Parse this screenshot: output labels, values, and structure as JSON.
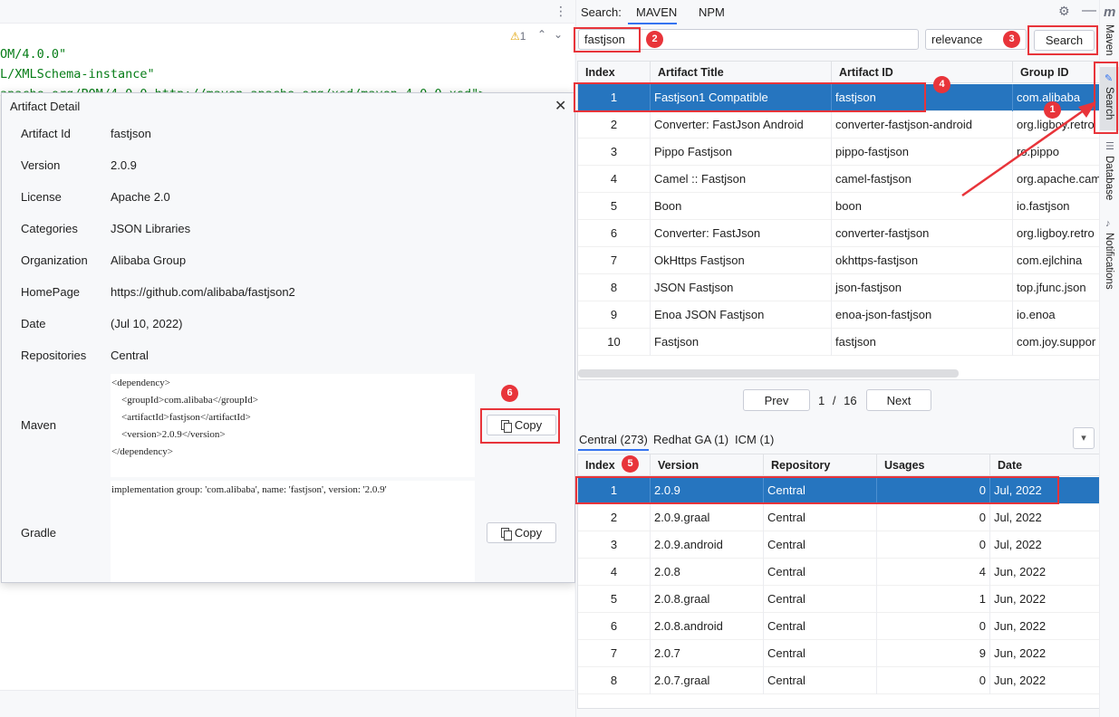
{
  "editor": {
    "code_lines": [
      "OM/4.0.0\"",
      "L/XMLSchema-instance\"",
      "apache.org/POM/4.0.0 http://maven.apache.org/xsd/maven-4.0.0.xsd\">"
    ],
    "warning_count": "1"
  },
  "dialog": {
    "title": "Artifact Detail",
    "fields": [
      {
        "label": "Artifact Id",
        "value": "fastjson"
      },
      {
        "label": "Version",
        "value": "2.0.9"
      },
      {
        "label": "License",
        "value": "Apache 2.0"
      },
      {
        "label": "Categories",
        "value": "JSON Libraries"
      },
      {
        "label": "Organization",
        "value": "Alibaba Group"
      },
      {
        "label": "HomePage",
        "value": "https://github.com/alibaba/fastjson2"
      },
      {
        "label": "Date",
        "value": "(Jul 10, 2022)"
      },
      {
        "label": "Repositories",
        "value": "Central"
      }
    ],
    "maven_label": "Maven",
    "maven_lines": [
      "<dependency>",
      "    <groupId>com.alibaba</groupId>",
      "    <artifactId>fastjson</artifactId>",
      "    <version>2.0.9</version>",
      "</dependency>"
    ],
    "gradle_label": "Gradle",
    "gradle_text": "implementation group: 'com.alibaba', name: 'fastjson', version: '2.0.9'",
    "copy_label": "Copy"
  },
  "panel": {
    "search_label": "Search:",
    "tabs": [
      "MAVEN",
      "NPM"
    ],
    "query": "fastjson",
    "sort": "relevance",
    "search_button": "Search",
    "artifact_columns": [
      "Index",
      "Artifact Title",
      "Artifact ID",
      "Group ID"
    ],
    "artifacts": [
      [
        "1",
        "Fastjson1 Compatible",
        "fastjson",
        "com.alibaba"
      ],
      [
        "2",
        "Converter: FastJson Android",
        "converter-fastjson-android",
        "org.ligboy.retro"
      ],
      [
        "3",
        "Pippo Fastjson",
        "pippo-fastjson",
        "ro.pippo"
      ],
      [
        "4",
        "Camel :: Fastjson",
        "camel-fastjson",
        "org.apache.cam"
      ],
      [
        "5",
        "Boon",
        "boon",
        "io.fastjson"
      ],
      [
        "6",
        "Converter: FastJson",
        "converter-fastjson",
        "org.ligboy.retro"
      ],
      [
        "7",
        "OkHttps Fastjson",
        "okhttps-fastjson",
        "com.ejlchina"
      ],
      [
        "8",
        "JSON Fastjson",
        "json-fastjson",
        "top.jfunc.json"
      ],
      [
        "9",
        "Enoa JSON Fastjson",
        "enoa-json-fastjson",
        "io.enoa"
      ],
      [
        "10",
        "Fastjson",
        "fastjson",
        "com.joy.suppor"
      ]
    ],
    "prev": "Prev",
    "next": "Next",
    "page_current": "1",
    "page_sep": "/",
    "page_total": "16",
    "repo_tabs": [
      "Central (273)",
      "Redhat GA (1)",
      "ICM (1)"
    ],
    "version_columns": [
      "Index",
      "Version",
      "Repository",
      "Usages",
      "Date"
    ],
    "versions": [
      [
        "1",
        "2.0.9",
        "Central",
        "0",
        "Jul, 2022"
      ],
      [
        "2",
        "2.0.9.graal",
        "Central",
        "0",
        "Jul, 2022"
      ],
      [
        "3",
        "2.0.9.android",
        "Central",
        "0",
        "Jul, 2022"
      ],
      [
        "4",
        "2.0.8",
        "Central",
        "4",
        "Jun, 2022"
      ],
      [
        "5",
        "2.0.8.graal",
        "Central",
        "1",
        "Jun, 2022"
      ],
      [
        "6",
        "2.0.8.android",
        "Central",
        "0",
        "Jun, 2022"
      ],
      [
        "7",
        "2.0.7",
        "Central",
        "9",
        "Jun, 2022"
      ],
      [
        "8",
        "2.0.7.graal",
        "Central",
        "0",
        "Jun, 2022"
      ]
    ]
  },
  "toolstrip": {
    "maven": "Maven",
    "search": "Search",
    "database": "Database",
    "notifications": "Notifications"
  },
  "badges": [
    "1",
    "2",
    "3",
    "4",
    "5",
    "6"
  ],
  "colors": {
    "selection": "#2675bf",
    "annotation": "#e8343a",
    "accent": "#3574f0"
  }
}
